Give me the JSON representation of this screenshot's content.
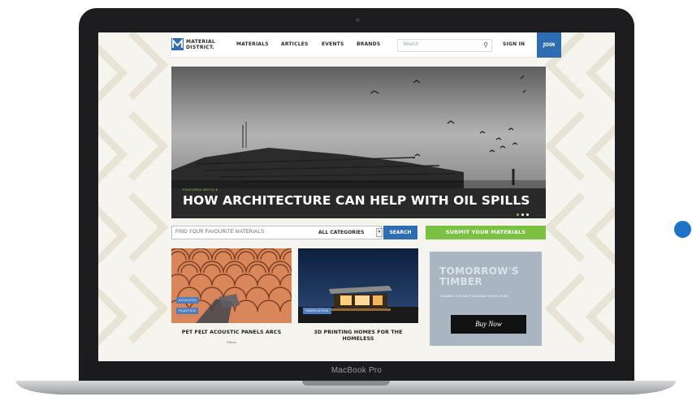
{
  "device": {
    "label": "MacBook Pro"
  },
  "nav": {
    "logo_line1": "MATERIAL",
    "logo_line2": "DISTRICT.",
    "links": [
      "MATERIALS",
      "ARTICLES",
      "EVENTS",
      "BRANDS"
    ],
    "search_placeholder": "Search",
    "sign_in": "SIGN IN",
    "join": "JOIN"
  },
  "hero": {
    "kicker": "FEATURED ARTICLE",
    "title": "HOW ARCHITECTURE CAN HELP WITH OIL SPILLS",
    "slide_count": 3,
    "active_slide": 1
  },
  "finder": {
    "placeholder": "FIND YOUR FAVOURITE MATERIALS",
    "category": "ALL CATEGORIES",
    "search_button": "SEARCH",
    "submit_button": "SUBMIT YOUR MATERIALS"
  },
  "cards": [
    {
      "tags": [
        "ACOUSTIC",
        "PLASTICS"
      ],
      "title_line1": "PET FELT ACOUSTIC PANELS ARCS",
      "title_line2": "",
      "brand": "Rahos"
    },
    {
      "tags": [
        "FABRICATION"
      ],
      "title_line1": "3D PRINTING HOMES FOR THE",
      "title_line2": "HOMELESS",
      "brand": ""
    }
  ],
  "ad": {
    "title_line1": "TOMORROW'S",
    "title_line2": "TIMBER",
    "subtitle": "TOWARDS THE NEXT BUILDING REVOLUTION",
    "button": "Buy Now"
  },
  "colors": {
    "brand_blue": "#2f6db3",
    "accent_green": "#7cc242",
    "page_bg": "#f6f4ee",
    "indicator_dot": "#1d73c7"
  }
}
